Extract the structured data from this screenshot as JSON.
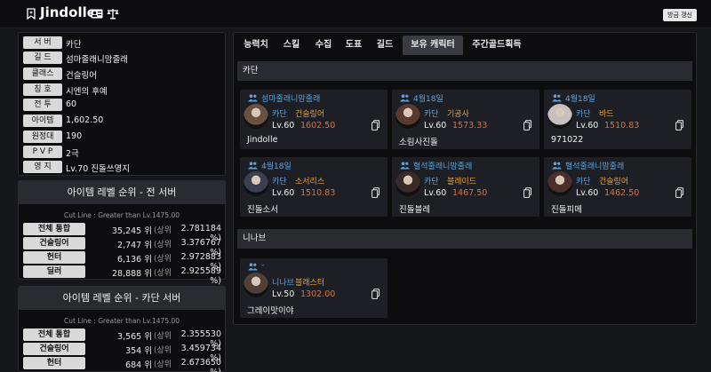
{
  "header": {
    "name": "Jindolle",
    "refresh_label": "방금 갱신"
  },
  "info": [
    {
      "label": "서 버",
      "value": "카단"
    },
    {
      "label": "길 드",
      "value": "섬마줄래니맘줄래"
    },
    {
      "label": "클래스",
      "value": "건슬링어"
    },
    {
      "label": "칭 호",
      "value": "시엔의 후예"
    },
    {
      "label": "전 투",
      "value": "60"
    },
    {
      "label": "아이템",
      "value": "1,602.50"
    },
    {
      "label": "원정대",
      "value": "190"
    },
    {
      "label": "P V P",
      "value": "2극"
    },
    {
      "label": "영 지",
      "value": "Lv.70 진돌쓰영지"
    }
  ],
  "rank_all": {
    "title": "아이템 레벨 순위 - 전 서버",
    "cutline": "Cut Line : Greater than Lv.1475.00",
    "rows": [
      {
        "cls": "전체 통합",
        "rank": "35,245 위",
        "sang": "(상위",
        "pct": "2.781184 %)"
      },
      {
        "cls": "건슬링어",
        "rank": "2,747 위",
        "sang": "(상위",
        "pct": "3.376767 %)"
      },
      {
        "cls": "헌터",
        "rank": "6,136 위",
        "sang": "(상위",
        "pct": "2.972883 %)"
      },
      {
        "cls": "딜러",
        "rank": "28,888 위",
        "sang": "(상위",
        "pct": "2.925589 %)"
      }
    ]
  },
  "rank_server": {
    "title": "아이템 레벨 순위 - 카단 서버",
    "cutline": "Cut Line : Greater than Lv.1475.00",
    "rows": [
      {
        "cls": "전체 통합",
        "rank": "3,565 위",
        "sang": "(상위",
        "pct": "2.355530 %)"
      },
      {
        "cls": "건슬링어",
        "rank": "354 위",
        "sang": "(상위",
        "pct": "3.459734 %)"
      },
      {
        "cls": "헌터",
        "rank": "684 위",
        "sang": "(상위",
        "pct": "2.673650 %)"
      }
    ]
  },
  "tabs": [
    "능력치",
    "스킬",
    "수집",
    "도표",
    "길드",
    "보유 캐릭터",
    "주간골드획득"
  ],
  "active_tab": "보유 캐릭터",
  "servers": [
    {
      "name": "카단",
      "chars": [
        {
          "guild": "섬마줄래니맘줄래",
          "server": "카단",
          "cls": "건슬링어",
          "lvl": "Lv.60",
          "ilvl": "1602.50",
          "name": "Jindolle",
          "avatar": "#6a5040"
        },
        {
          "guild": "4월18일",
          "server": "카단",
          "cls": "기공사",
          "lvl": "Lv.60",
          "ilvl": "1573.33",
          "name": "소림사진돌",
          "avatar": "#5a3a30"
        },
        {
          "guild": "4월18일",
          "server": "카단",
          "cls": "바드",
          "lvl": "Lv.60",
          "ilvl": "1510.83",
          "name": "971022",
          "avatar": "#c8c0c0"
        },
        {
          "guild": "4월18일",
          "server": "카단",
          "cls": "소서리스",
          "lvl": "Lv.60",
          "ilvl": "1510.83",
          "name": "진돌소서",
          "avatar": "#3a4050"
        },
        {
          "guild": "혈석줄래니맘줄래",
          "server": "카단",
          "cls": "블레이드",
          "lvl": "Lv.60",
          "ilvl": "1467.50",
          "name": "진돌블레",
          "avatar": "#3a2a28"
        },
        {
          "guild": "혈석줄래니맘줄래",
          "server": "카단",
          "cls": "건슬링어",
          "lvl": "Lv.60",
          "ilvl": "1462.50",
          "name": "진돌피메",
          "avatar": "#4a3028"
        }
      ]
    },
    {
      "name": "니나브",
      "chars": [
        {
          "guild": "-",
          "server": "니나브",
          "cls": "블래스터",
          "lvl": "Lv.50",
          "ilvl": "1302.00",
          "name": "그레이맛이야",
          "avatar": "#504038"
        }
      ]
    }
  ],
  "colors": {
    "accent_blue": "#5aa3e0",
    "accent_orange": "#e8a030",
    "ilvl_orange": "#e07030"
  }
}
